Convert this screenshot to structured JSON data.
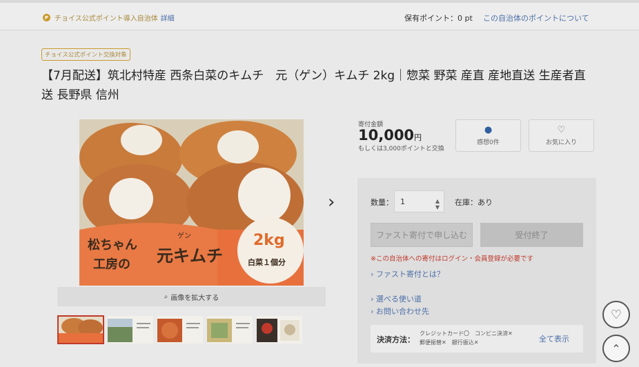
{
  "topbar": {
    "p_icon": "P",
    "notice": "チョイス公式ポイント導入自治体",
    "detail_link": "詳細",
    "points_label": "保有ポイント：0 pt",
    "points_link": "この自治体のポイントについて"
  },
  "product": {
    "badge": "チョイス公式ポイント交換対象",
    "title": "【7月配送】筑北村特産 西条白菜のキムチ　元（ゲン）キムチ 2kg｜惣菜 野菜 産直 産地直送 生産者直送 長野県 信州",
    "image_text": {
      "brand_line1": "松ちゃん",
      "brand_line2": "工房の",
      "product_name": "元キムチ",
      "furigana": "ゲン",
      "weight": "2kg",
      "portion": "白菜１個分"
    },
    "zoom_label": "画像を拡大する",
    "next_icon": "chevron-right-icon"
  },
  "price": {
    "label": "寄付金額",
    "amount": "10,000",
    "unit": "円",
    "alt_points": "もしくは3,000ポイントと交換"
  },
  "actions": {
    "review_label": "感想0件",
    "favorite_label": "お気に入り"
  },
  "order": {
    "qty_label": "数量：",
    "qty_value": "1",
    "stock_label": "在庫：あり",
    "fast_button": "ファスト寄付で申し込む",
    "closed_button": "受付終了",
    "warning": "※この自治体への寄付はログイン・会員登録が必要です",
    "link_fast": "› ファスト寄付とは？",
    "link_usage": "› 選べる使い道",
    "link_contact": "› お問い合わせ先",
    "pay_label": "決済方法：",
    "pay_line1": "クレジットカード〇　コンビニ決済✕",
    "pay_line2": "郵便振替✕　銀行振込✕",
    "pay_all": "全て表示"
  },
  "colors": {
    "accent_gold": "#c99a2e",
    "link_blue": "#4b6fa8",
    "warning_red": "#c0392b"
  }
}
